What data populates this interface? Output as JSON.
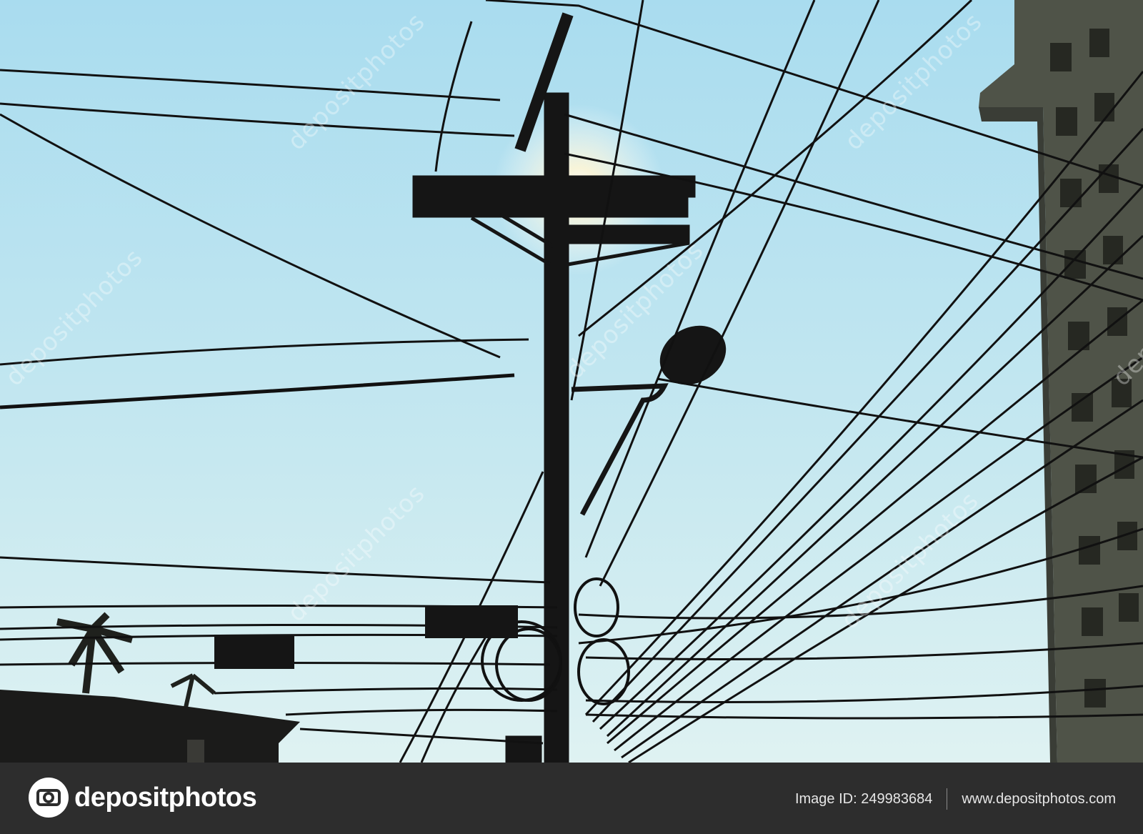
{
  "image": {
    "subject": "utility-pole-with-tangled-cables",
    "colors": {
      "sky_top": "#a9dcef",
      "sky_bottom": "#d9f0f3",
      "silhouette": "#141414",
      "sun": "#fff9e0"
    }
  },
  "watermark": {
    "text": "depositphotos"
  },
  "footer": {
    "brand_name": "depositphotos",
    "image_id_label": "Image ID: 249983684",
    "website": "www.depositphotos.com",
    "colors": {
      "background": "#2d2d2d",
      "text": "#ffffff"
    }
  }
}
